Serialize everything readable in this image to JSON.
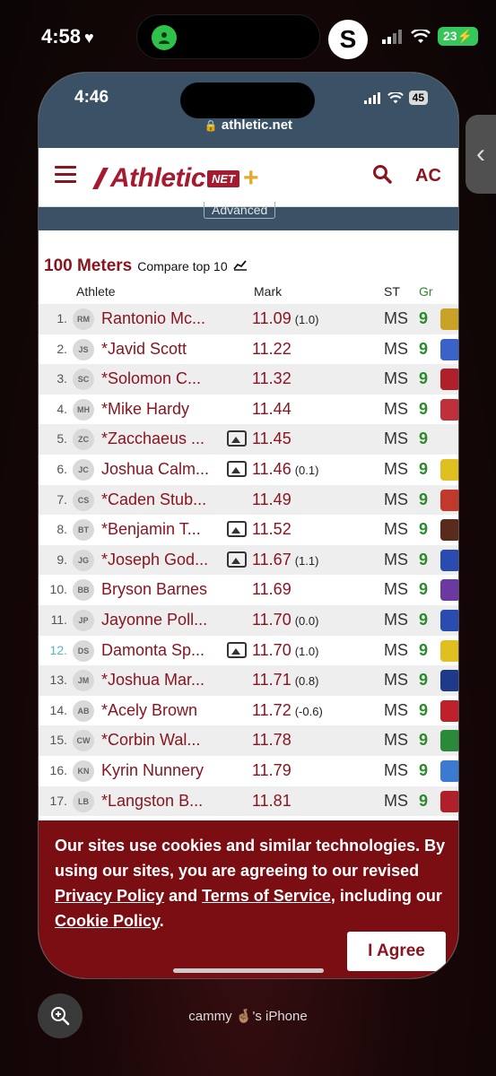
{
  "outer_status": {
    "time": "4:58",
    "s_label": "S",
    "battery": "23"
  },
  "phone_status": {
    "time": "4:46",
    "battery": "45",
    "url": "athletic.net"
  },
  "site": {
    "logo_word": "Athletic",
    "logo_net": "NET",
    "account": "AC",
    "advanced": "Advanced"
  },
  "event": {
    "title": "100 Meters",
    "compare": "Compare top 10"
  },
  "columns": {
    "athlete": "Athlete",
    "mark": "Mark",
    "st": "ST",
    "gr": "Gr"
  },
  "accent_color": "#8a1520",
  "grade_color": "#2b8a2b",
  "rows": [
    {
      "rank": "1.",
      "initials": "RM",
      "name": "Rantonio Mc...",
      "media": false,
      "mark": "11.09",
      "wind": "(1.0)",
      "st": "MS",
      "gr": "9",
      "team": "#c9a227"
    },
    {
      "rank": "2.",
      "initials": "JS",
      "name": "*Javid Scott",
      "media": false,
      "mark": "11.22",
      "wind": "",
      "st": "MS",
      "gr": "9",
      "team": "#3a62c9"
    },
    {
      "rank": "3.",
      "initials": "SC",
      "name": "*Solomon C...",
      "media": false,
      "mark": "11.32",
      "wind": "",
      "st": "MS",
      "gr": "9",
      "team": "#b0202a"
    },
    {
      "rank": "4.",
      "initials": "MH",
      "name": "*Mike Hardy",
      "media": false,
      "mark": "11.44",
      "wind": "",
      "st": "MS",
      "gr": "9",
      "team": "#c0303a"
    },
    {
      "rank": "5.",
      "initials": "ZC",
      "name": "*Zacchaeus ...",
      "media": true,
      "mark": "11.45",
      "wind": "",
      "st": "MS",
      "gr": "9",
      "team": ""
    },
    {
      "rank": "6.",
      "initials": "JC",
      "name": "Joshua Calm...",
      "media": true,
      "mark": "11.46",
      "wind": "(0.1)",
      "st": "MS",
      "gr": "9",
      "team": "#e0c020"
    },
    {
      "rank": "7.",
      "initials": "CS",
      "name": "*Caden Stub...",
      "media": false,
      "mark": "11.49",
      "wind": "",
      "st": "MS",
      "gr": "9",
      "team": "#c0392b"
    },
    {
      "rank": "8.",
      "initials": "BT",
      "name": "*Benjamin T...",
      "media": true,
      "mark": "11.52",
      "wind": "",
      "st": "MS",
      "gr": "9",
      "team": "#5a2a1a"
    },
    {
      "rank": "9.",
      "initials": "JG",
      "name": "*Joseph God...",
      "media": true,
      "mark": "11.67",
      "wind": "(1.1)",
      "st": "MS",
      "gr": "9",
      "team": "#2a4bb0"
    },
    {
      "rank": "10.",
      "initials": "BB",
      "name": "Bryson Barnes",
      "media": false,
      "mark": "11.69",
      "wind": "",
      "st": "MS",
      "gr": "9",
      "team": "#6a3aa0"
    },
    {
      "rank": "11.",
      "initials": "JP",
      "name": "Jayonne Poll...",
      "media": false,
      "mark": "11.70",
      "wind": "(0.0)",
      "st": "MS",
      "gr": "9",
      "team": "#2a4bb0"
    },
    {
      "rank": "12.",
      "initials": "DS",
      "name": "Damonta Sp...",
      "media": true,
      "mark": "11.70",
      "wind": "(1.0)",
      "st": "MS",
      "gr": "9",
      "team": "#e0c020",
      "highlight": true
    },
    {
      "rank": "13.",
      "initials": "JM",
      "name": "*Joshua Mar...",
      "media": false,
      "mark": "11.71",
      "wind": "(0.8)",
      "st": "MS",
      "gr": "9",
      "team": "#1e3a8a"
    },
    {
      "rank": "14.",
      "initials": "AB",
      "name": "*Acely Brown",
      "media": false,
      "mark": "11.72",
      "wind": "(-0.6)",
      "st": "MS",
      "gr": "9",
      "team": "#c0202a"
    },
    {
      "rank": "15.",
      "initials": "CW",
      "name": "*Corbin Wal...",
      "media": false,
      "mark": "11.78",
      "wind": "",
      "st": "MS",
      "gr": "9",
      "team": "#2a8a3a"
    },
    {
      "rank": "16.",
      "initials": "KN",
      "name": "Kyrin Nunnery",
      "media": false,
      "mark": "11.79",
      "wind": "",
      "st": "MS",
      "gr": "9",
      "team": "#3a7ad0"
    },
    {
      "rank": "17.",
      "initials": "LB",
      "name": "*Langston B...",
      "media": false,
      "mark": "11.81",
      "wind": "",
      "st": "MS",
      "gr": "9",
      "team": "#b0202a"
    }
  ],
  "cookie": {
    "text_1": "Our sites use cookies and similar technologies. By using our sites, you are agreeing to our revised ",
    "privacy": "Privacy Policy",
    "and": " and ",
    "terms": "Terms of Service",
    "text_2": ", including our ",
    "cookie_policy": "Cookie Policy",
    "end": ".",
    "agree": "I Agree"
  },
  "device_name": "cammy 🤞🏽's iPhone"
}
